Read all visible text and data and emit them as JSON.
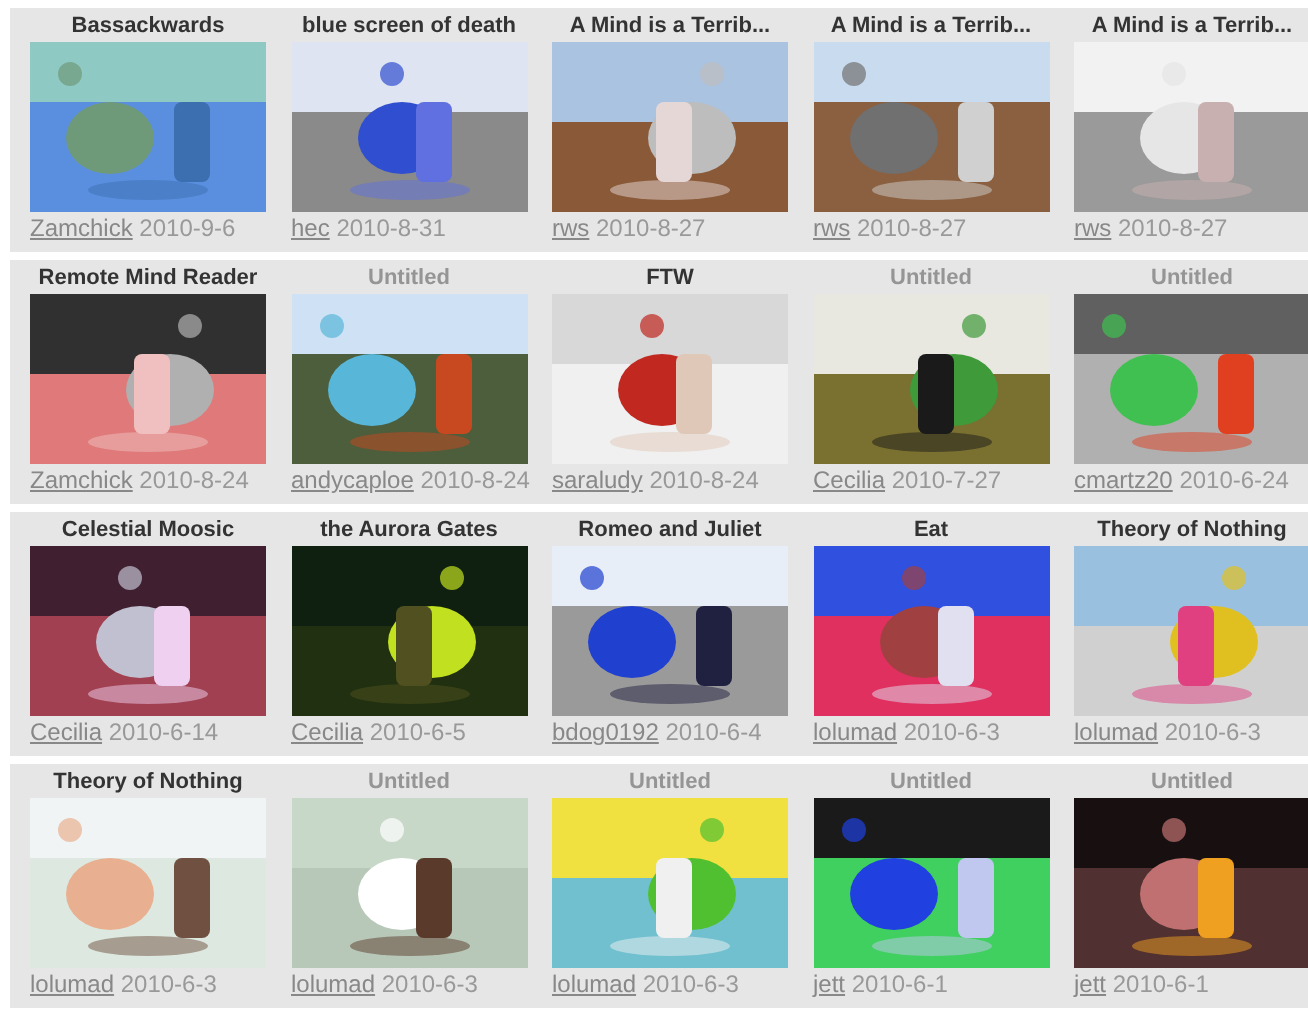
{
  "rows": [
    {
      "items": [
        {
          "title": "Bassackwards",
          "untitled": false,
          "user": "Zamchick",
          "date": "2010-9-6"
        },
        {
          "title": "blue screen of death",
          "untitled": false,
          "user": "hec",
          "date": "2010-8-31"
        },
        {
          "title": "A Mind is a Terrib...",
          "untitled": false,
          "user": "rws",
          "date": "2010-8-27"
        },
        {
          "title": "A Mind is a Terrib...",
          "untitled": false,
          "user": "rws",
          "date": "2010-8-27"
        },
        {
          "title": "A Mind is a Terrib...",
          "untitled": false,
          "user": "rws",
          "date": "2010-8-27"
        }
      ]
    },
    {
      "items": [
        {
          "title": "Remote Mind Reader",
          "untitled": false,
          "user": "Zamchick",
          "date": "2010-8-24"
        },
        {
          "title": "Untitled",
          "untitled": true,
          "user": "andycaploe",
          "date": "2010-8-24"
        },
        {
          "title": "FTW",
          "untitled": false,
          "user": "saraludy",
          "date": "2010-8-24"
        },
        {
          "title": "Untitled",
          "untitled": true,
          "user": "Cecilia",
          "date": "2010-7-27"
        },
        {
          "title": "Untitled",
          "untitled": true,
          "user": "cmartz20",
          "date": "2010-6-24"
        }
      ]
    },
    {
      "items": [
        {
          "title": "Celestial Moosic",
          "untitled": false,
          "user": "Cecilia",
          "date": "2010-6-14"
        },
        {
          "title": "the Aurora Gates",
          "untitled": false,
          "user": "Cecilia",
          "date": "2010-6-5"
        },
        {
          "title": "Romeo and Juliet",
          "untitled": false,
          "user": "bdog0192",
          "date": "2010-6-4"
        },
        {
          "title": "Eat",
          "untitled": false,
          "user": "lolumad",
          "date": "2010-6-3"
        },
        {
          "title": "Theory of Nothing",
          "untitled": false,
          "user": "lolumad",
          "date": "2010-6-3"
        }
      ]
    },
    {
      "items": [
        {
          "title": "Theory of Nothing",
          "untitled": false,
          "user": "lolumad",
          "date": "2010-6-3"
        },
        {
          "title": "Untitled",
          "untitled": true,
          "user": "lolumad",
          "date": "2010-6-3"
        },
        {
          "title": "Untitled",
          "untitled": true,
          "user": "lolumad",
          "date": "2010-6-3"
        },
        {
          "title": "Untitled",
          "untitled": true,
          "user": "jett",
          "date": "2010-6-1"
        },
        {
          "title": "Untitled",
          "untitled": true,
          "user": "jett",
          "date": "2010-6-1"
        }
      ]
    }
  ]
}
